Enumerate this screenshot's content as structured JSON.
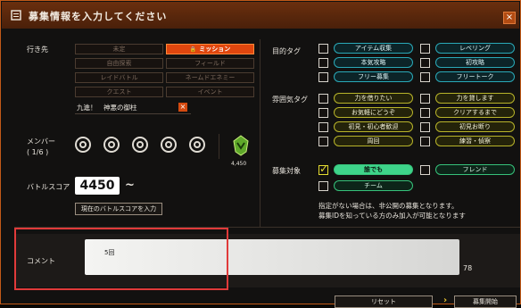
{
  "window": {
    "title": "募集情報を入力してください",
    "close_label": "×"
  },
  "destination": {
    "label": "行き先",
    "options": [
      {
        "label": "未定",
        "selected": false
      },
      {
        "label": "ミッション",
        "selected": true
      },
      {
        "label": "自由探索",
        "selected": false
      },
      {
        "label": "フィールド",
        "selected": false
      },
      {
        "label": "レイドバトル",
        "selected": false
      },
      {
        "label": "ネームドエネミー",
        "selected": false
      },
      {
        "label": "クエスト",
        "selected": false
      },
      {
        "label": "イベント",
        "selected": false
      }
    ],
    "selected_detail": "九進！　神悪の御柱"
  },
  "members": {
    "label": "メンバー",
    "count": "( 1/6 )",
    "rank_value": "4,450"
  },
  "battle_score": {
    "label": "バトルスコア",
    "value": "4450",
    "suffix": "~",
    "button_label": "現在のバトルスコアを入力"
  },
  "purpose_tags": {
    "label": "目的タグ",
    "items": [
      {
        "label": "アイテム収集",
        "checked": false
      },
      {
        "label": "レベリング",
        "checked": false
      },
      {
        "label": "本気攻略",
        "checked": false
      },
      {
        "label": "初攻略",
        "checked": false
      },
      {
        "label": "フリー募集",
        "checked": false
      },
      {
        "label": "フリートーク",
        "checked": false
      }
    ]
  },
  "mood_tags": {
    "label": "雰囲気タグ",
    "items": [
      {
        "label": "力を借りたい",
        "checked": false
      },
      {
        "label": "力を貸します",
        "checked": false
      },
      {
        "label": "お気軽にどうぞ",
        "checked": false
      },
      {
        "label": "クリアするまで",
        "checked": false
      },
      {
        "label": "初見・初心者歓迎",
        "checked": false
      },
      {
        "label": "初見お断り",
        "checked": false
      },
      {
        "label": "周回",
        "checked": false
      },
      {
        "label": "練習・偵察",
        "checked": false
      }
    ]
  },
  "recruit_target": {
    "label": "募集対象",
    "items": [
      {
        "label": "誰でも",
        "checked": true
      },
      {
        "label": "フレンド",
        "checked": false
      },
      {
        "label": "チーム",
        "checked": false
      }
    ],
    "note_line1": "指定がない場合は、非公開の募集となります。",
    "note_line2": "募集IDを知っている方のみ加入が可能となります"
  },
  "comment": {
    "label": "コメント",
    "value": "5回",
    "remaining": "78"
  },
  "footer": {
    "reset_label": "リセット",
    "start_label": "募集開始",
    "start_chevron": "›"
  },
  "colors": {
    "accent_orange": "#e0460e",
    "tag_teal": "#2aa9b8",
    "tag_yellow": "#b8b42a",
    "tag_green": "#36c27a",
    "highlight_red": "#e03a3a"
  }
}
